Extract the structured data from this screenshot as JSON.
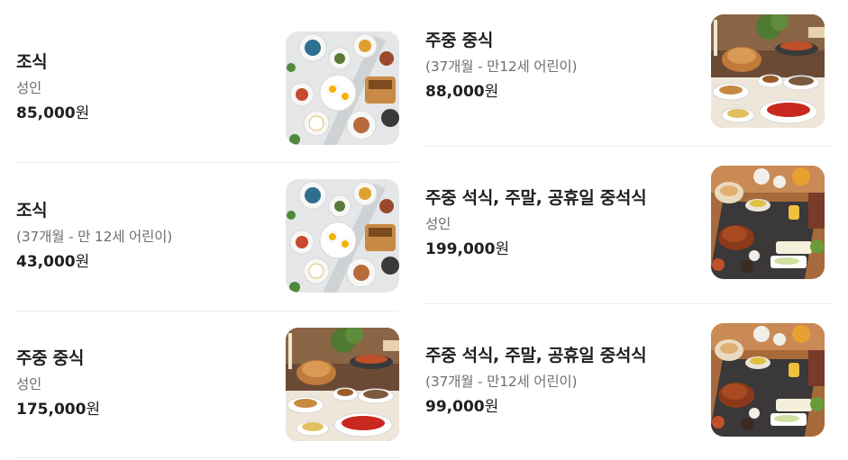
{
  "currency_unit": "원",
  "left_column": [
    {
      "name": "조식",
      "sub": "성인",
      "price": "85,000",
      "image": "breakfast-photo"
    },
    {
      "name": "조식",
      "sub": "(37개월 - 만 12세 어린이)",
      "price": "43,000",
      "image": "breakfast-photo"
    },
    {
      "name": "주중 중식",
      "sub": "성인",
      "price": "175,000",
      "image": "lunch-buffet-photo"
    }
  ],
  "right_column": [
    {
      "name": "주중 중식",
      "sub": "(37개월 - 만12세 어린이)",
      "price": "88,000",
      "image": "lunch-buffet-photo"
    },
    {
      "name": "주중 석식, 주말, 공휴일 중석식",
      "sub": "성인",
      "price": "199,000",
      "image": "dinner-buffet-photo"
    },
    {
      "name": "주중 석식, 주말, 공휴일 중석식",
      "sub": "(37개월 - 만12세 어린이)",
      "price": "99,000",
      "image": "dinner-buffet-photo"
    }
  ]
}
